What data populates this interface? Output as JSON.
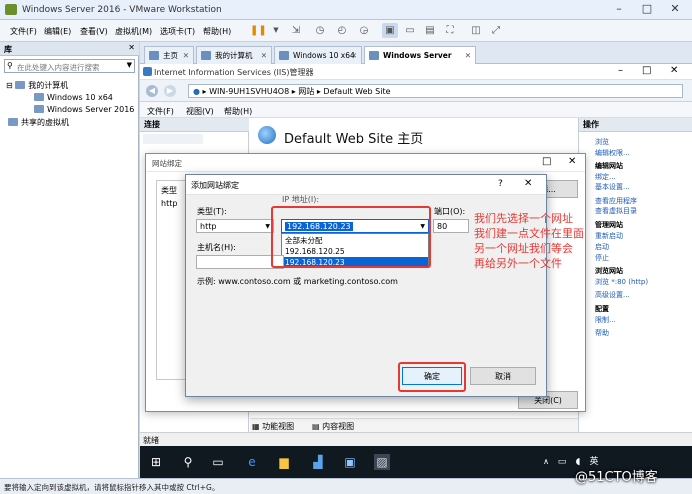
{
  "vmware": {
    "title": "Windows Server 2016 - VMware Workstation",
    "menu": [
      "文件(F)",
      "编辑(E)",
      "查看(V)",
      "虚拟机(M)",
      "选项卡(T)",
      "帮助(H)"
    ],
    "library_title": "库",
    "search_placeholder": "在此处键入内容进行搜索",
    "tree": {
      "root": "我的计算机",
      "vm1": "Windows 10 x64",
      "vm2": "Windows Server 2016",
      "shared": "共享的虚拟机"
    },
    "tabs": [
      "主页",
      "我的计算机",
      "Windows 10 x64",
      "Windows Server 2016"
    ],
    "status": "要将输入定向到该虚拟机，请将鼠标指针移入其中或按 Ctrl+G。"
  },
  "iis": {
    "title": "Internet Information Services (IIS)管理器",
    "address": [
      "WIN-9UH1SVHU4O8",
      "网站",
      "Default Web Site"
    ],
    "menu": [
      "文件(F)",
      "视图(V)",
      "帮助(H)"
    ],
    "connections": "连接",
    "site_title": "Default Web Site 主页",
    "view_tabs": [
      "功能视图",
      "内容视图"
    ],
    "status": "就绪",
    "actions": {
      "head": "操作",
      "items": [
        "浏览",
        "编辑权限...",
        "编辑网站",
        "绑定...",
        "基本设置...",
        "查看应用程序",
        "查看虚拟目录",
        "管理网站",
        "重新启动",
        "启动",
        "停止",
        "浏览网站",
        "浏览 *:80 (http)",
        "高级设置...",
        "配置",
        "限制...",
        "帮助"
      ]
    }
  },
  "dialog_bindings": {
    "title": "网站绑定",
    "col_type": "类型",
    "row_type": "http",
    "add_btn": "添...",
    "close_btn": "关闭(C)"
  },
  "dialog_add": {
    "title": "添加网站绑定",
    "help": "?",
    "type_label": "类型(T):",
    "type_value": "http",
    "ip_label": "IP 地址(I):",
    "ip_value": "192.168.120.23",
    "ip_options": [
      "全部未分配",
      "192.168.120.25",
      "192.168.120.23"
    ],
    "ip_selected_index": 2,
    "port_label": "端口(O):",
    "port_value": "80",
    "host_label": "主机名(H):",
    "host_value": "",
    "example": "示例: www.contoso.com 或 marketing.contoso.com",
    "ok": "确定",
    "cancel": "取消"
  },
  "annotation": [
    "我们先选择一个网址",
    "我们建一点文件在里面",
    "另一个网址我们等会",
    "再给另外一个文件"
  ],
  "taskbar": {
    "lang": "英"
  },
  "watermark": "@51CTO博客",
  "colors": {
    "annotation": "#e53935",
    "selection": "#0a64d6",
    "link": "#1d5bb8"
  }
}
